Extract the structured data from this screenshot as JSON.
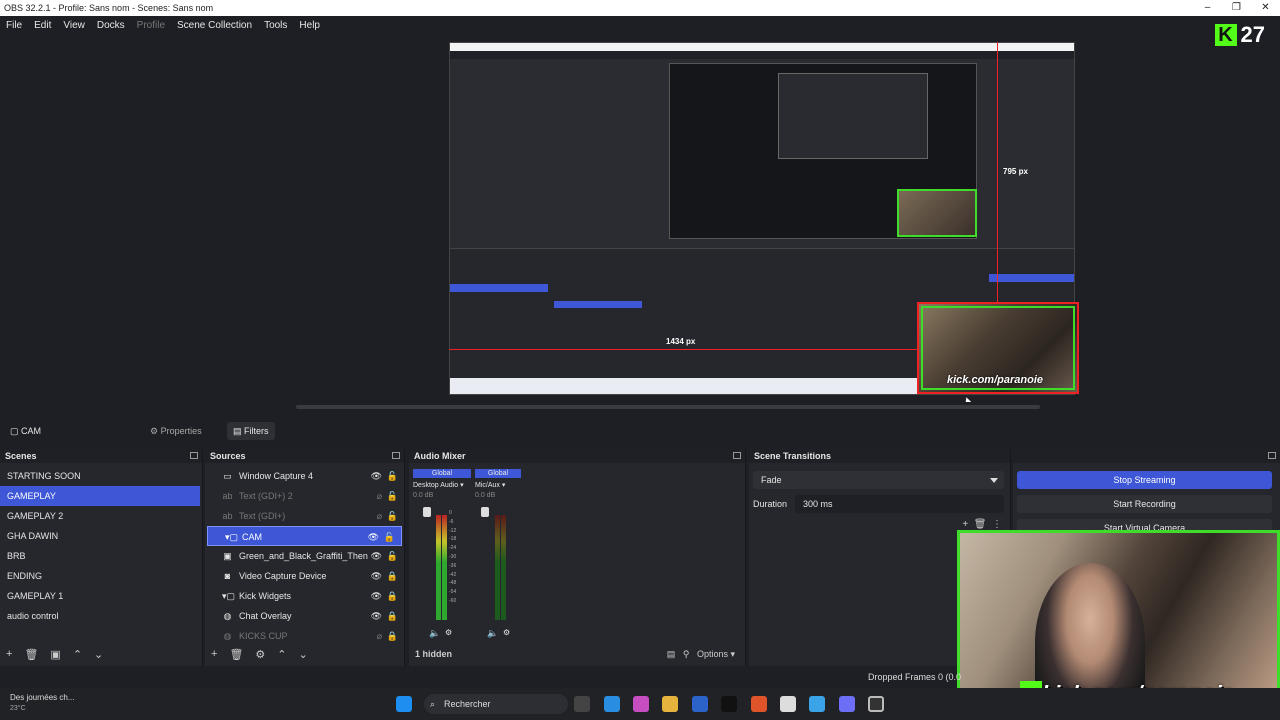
{
  "window": {
    "title": "OBS 32.2.1 - Profile: Sans nom - Scenes: Sans nom",
    "controls": [
      "–",
      "❐",
      "✕"
    ]
  },
  "menu": {
    "items": [
      "File",
      "Edit",
      "View",
      "Docks",
      "Profile",
      "Scene Collection",
      "Tools",
      "Help"
    ]
  },
  "preview": {
    "measure_vertical": "795 px",
    "measure_horizontal": "1434 px",
    "kick_overlay_text": "kick.com/paranoie",
    "kick_badge_count": "27"
  },
  "source_toolbar": {
    "selected_source": "CAM",
    "properties_label": "Properties",
    "filters_label": "Filters"
  },
  "scenes": {
    "title": "Scenes",
    "items": [
      "STARTING SOON",
      "GAMEPLAY",
      "GAMEPLAY 2",
      "GHA DAWIN",
      "BRB",
      "ENDING",
      "GAMEPLAY 1",
      "audio control"
    ],
    "selected_index": 1
  },
  "sources": {
    "title": "Sources",
    "items": [
      {
        "label": "Window Capture 4",
        "icon": "window-icon",
        "visible": true
      },
      {
        "label": "Text (GDI+) 2",
        "icon": "text-icon",
        "visible": false
      },
      {
        "label": "Text (GDI+)",
        "icon": "text-icon",
        "visible": false
      },
      {
        "label": "CAM",
        "icon": "folder-icon",
        "visible": true,
        "selected": true
      },
      {
        "label": "Green_and_Black_Graffiti_Then",
        "icon": "image-icon",
        "visible": true
      },
      {
        "label": "Video Capture Device",
        "icon": "camera-icon",
        "visible": true
      },
      {
        "label": "Kick Widgets",
        "icon": "folder-icon",
        "visible": true
      },
      {
        "label": "Chat Overlay",
        "icon": "browser-icon",
        "visible": true
      },
      {
        "label": "KICKS CUP",
        "icon": "browser-icon",
        "visible": false
      }
    ]
  },
  "audio_mixer": {
    "title": "Audio Mixer",
    "channels": [
      {
        "scope": "Global",
        "name": "Desktop Audio",
        "level_db": "0.0 dB",
        "level": 0.35
      },
      {
        "scope": "Global",
        "name": "Mic/Aux",
        "level_db": "0.0 dB",
        "level": 0.05
      }
    ],
    "scale": [
      "0",
      "-6",
      "-12",
      "-18",
      "-24",
      "-30",
      "-36",
      "-42",
      "-48",
      "-54",
      "-60"
    ],
    "hidden_count": "1 hidden",
    "options_label": "Options"
  },
  "transitions": {
    "title": "Scene Transitions",
    "transition": "Fade",
    "duration_label": "Duration",
    "duration_value": "300 ms"
  },
  "controls": {
    "title": "Controls",
    "stop_streaming": "Stop Streaming",
    "start_recording": "Start Recording",
    "start_virtual_camera": "Start Virtual Camera"
  },
  "webcam": {
    "overlay_text": "kick.com/paranoie"
  },
  "status": {
    "dropped_frames": "Dropped Frames 0 (0.0"
  },
  "taskbar": {
    "weather_line1": "Des journées ch...",
    "weather_line2": "23°C",
    "search_placeholder": "Rechercher"
  },
  "colors": {
    "accent": "#3d57d6",
    "kick_green": "#53fc18",
    "background": "#1e1f24",
    "panel": "#26272c"
  }
}
